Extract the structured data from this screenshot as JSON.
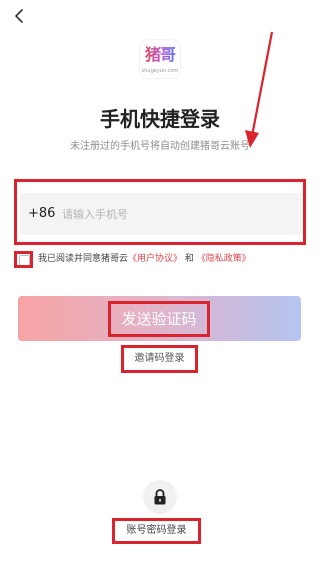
{
  "header": {
    "back_icon": "chevron-left-icon"
  },
  "logo": {
    "mark": "猪哥云",
    "caption": "zhugeyun.com"
  },
  "title": "手机快捷登录",
  "subtitle": "未注册过的手机号将自动创建猪哥云账号",
  "phone": {
    "country_code": "+86",
    "placeholder": "请输入手机号",
    "value": ""
  },
  "agreement": {
    "checked": false,
    "prefix": "我已阅读并同意猪哥云",
    "user_agreement": "《用户协议》",
    "conjunction": "和",
    "privacy_policy": "《隐私政策》"
  },
  "send_code_label": "发送验证码",
  "invite_code_link": "邀请码登录",
  "lock_icon": "lock-icon",
  "account_password_link": "账号密码登录",
  "colors": {
    "annotation_red": "#d9232d",
    "link_red": "#e0454c",
    "button_gradient_start": "#f7a3a3",
    "button_gradient_end": "#b6c5f2"
  }
}
